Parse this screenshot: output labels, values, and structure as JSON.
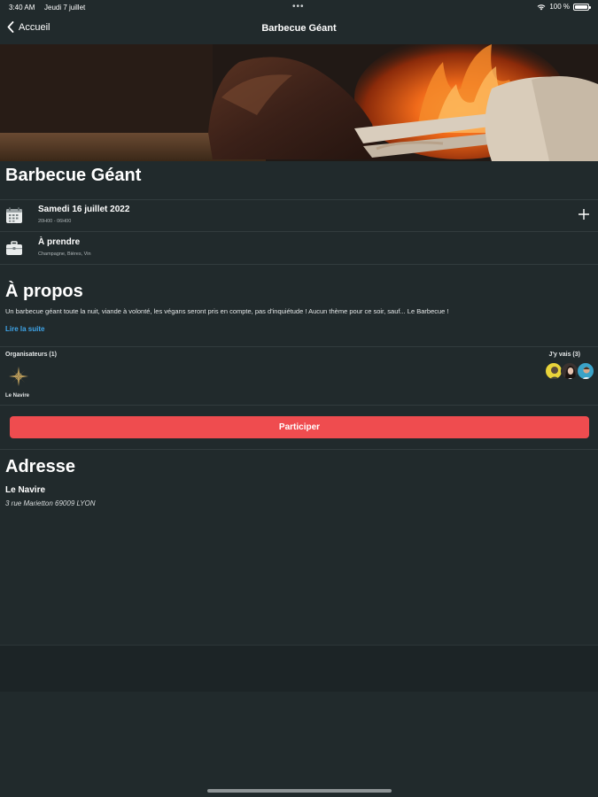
{
  "status_bar": {
    "time": "3:40 AM",
    "date": "Jeudi 7 juillet",
    "dots": "•••",
    "battery_text": "100 %",
    "wifi_icon": "wifi-icon",
    "battery_icon": "battery-icon",
    "battery_level": 1.0
  },
  "nav": {
    "back_label": "Accueil",
    "back_icon": "chevron-left-icon",
    "title": "Barbecue Géant"
  },
  "event": {
    "title": "Barbecue Géant",
    "date_label": "Samedi 16 juillet 2022",
    "time_range": "20H00 - 06H00",
    "date_icon": "calendar-icon",
    "add_icon": "plus-icon",
    "bring_label": "À prendre",
    "bring_items": "Champagne, Bières, Vin",
    "bring_icon": "briefcase-icon"
  },
  "about": {
    "title": "À propos",
    "text": "Un barbecue géant toute la nuit, viande à volonté, les végans seront pris en compte, pas d'inquiétude ! Aucun thème pour ce soir, sauf... Le Barbecue !",
    "read_more": "Lire la suite"
  },
  "organizers": {
    "label": "Organisateurs (1)",
    "items": [
      {
        "name": "Le Navire",
        "icon": "compass-rose-icon"
      }
    ]
  },
  "attendees": {
    "label": "J'y vais (3)",
    "colors": [
      "#e8d33a",
      "#3a3230",
      "#3aa3c8"
    ]
  },
  "participate_label": "Participer",
  "address": {
    "title": "Adresse",
    "name": "Le Navire",
    "street": "3 rue Marietton 69009 LYON"
  },
  "colors": {
    "background": "#212a2c",
    "accent_red": "#ef4c4f",
    "link_blue": "#3fa6ea"
  }
}
